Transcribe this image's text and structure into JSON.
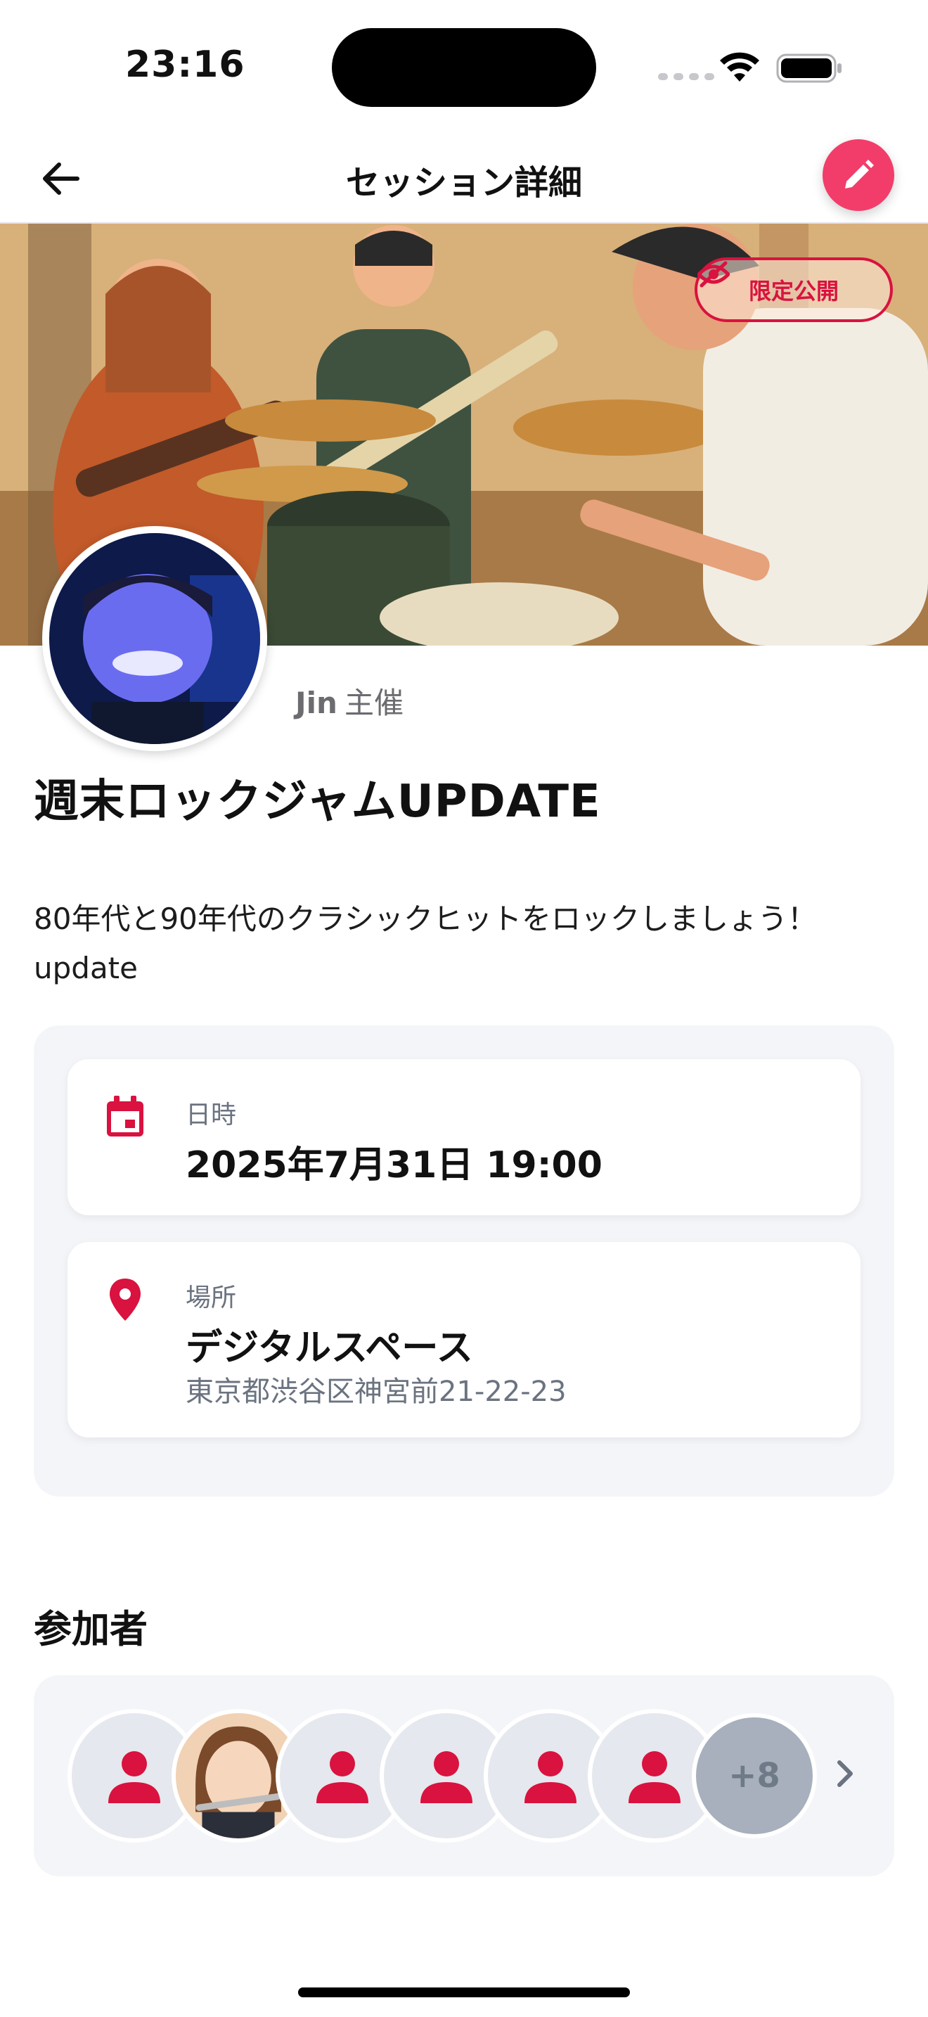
{
  "status_bar": {
    "time": "23:16"
  },
  "nav": {
    "title": "セッション詳細"
  },
  "hero": {
    "visibility_label": "限定公開"
  },
  "host": {
    "name": "Jin",
    "suffix": "主催"
  },
  "session": {
    "title": "週末ロックジャムUPDATE",
    "description": "80年代と90年代のクラシックヒットをロックしましょう！update"
  },
  "details": {
    "datetime": {
      "label": "日時",
      "value": "2025年7月31日 19:00"
    },
    "place": {
      "label": "場所",
      "name": "デジタルスペース",
      "address": "東京都渋谷区神宮前21-22-23"
    }
  },
  "participants": {
    "heading": "参加者",
    "more_label": "+8",
    "avatars": [
      "person-icon",
      "illustrated-photo",
      "person-icon",
      "person-icon",
      "person-icon",
      "person-icon"
    ]
  },
  "colors": {
    "accent": "#d9123f",
    "edit_fab": "#f23d6b"
  }
}
